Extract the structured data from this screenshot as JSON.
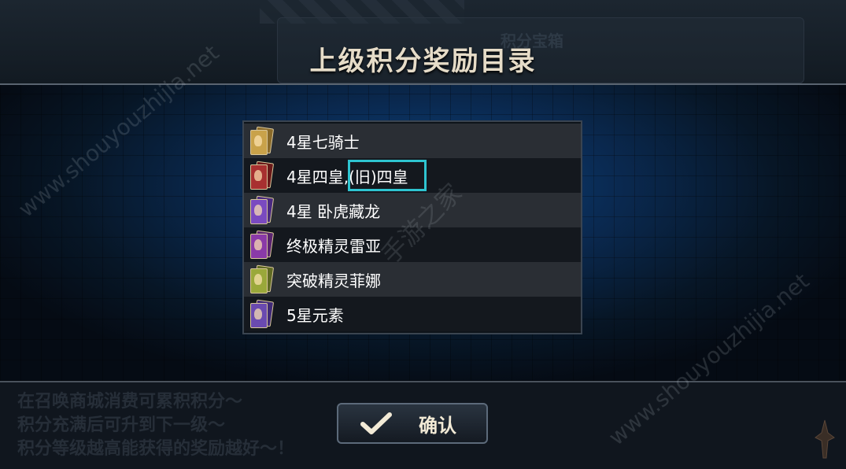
{
  "dialog": {
    "title": "上级积分奖励目录",
    "background_panel_title": "积分宝箱"
  },
  "reward_list": [
    {
      "label": "4星七骑士",
      "card_color": "#c9a24a"
    },
    {
      "label": "4星四皇,(旧)四皇",
      "card_color": "#a83030"
    },
    {
      "label": "4星 卧虎藏龙",
      "card_color": "#7a4ac0"
    },
    {
      "label": "终极精灵雷亚",
      "card_color": "#8a3aa8"
    },
    {
      "label": "突破精灵菲娜",
      "card_color": "#9aa83a"
    },
    {
      "label": "5星元素",
      "card_color": "#6a4ab0"
    }
  ],
  "tips": [
    "在召唤商城消费可累积积分～",
    "积分充满后可升到下一级～",
    "积分等级越高能获得的奖励越好～！"
  ],
  "confirm": {
    "label": "确认",
    "icon": "check-icon"
  },
  "watermark": {
    "url": "www.shouyouzhijia.net",
    "brand": "手游之家"
  },
  "colors": {
    "highlight": "#2ec4d0",
    "title": "#e6dcc8"
  }
}
